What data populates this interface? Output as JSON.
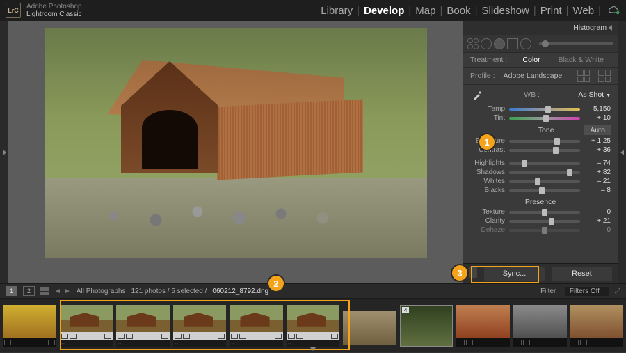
{
  "app": {
    "vendor": "Adobe Photoshop",
    "name": "Lightroom Classic",
    "logo": "LrC"
  },
  "modules": {
    "items": [
      "Library",
      "Develop",
      "Map",
      "Book",
      "Slideshow",
      "Print",
      "Web"
    ],
    "active": "Develop"
  },
  "panel": {
    "histogram_label": "Histogram",
    "treatment_label": "Treatment :",
    "treatment_color": "Color",
    "treatment_bw": "Black & White",
    "profile_label": "Profile :",
    "profile_value": "Adobe Landscape",
    "wb_label": "WB :",
    "wb_value": "As Shot",
    "temp": {
      "label": "Temp",
      "value": "5,150",
      "pos": 55
    },
    "tint": {
      "label": "Tint",
      "value": "+ 10",
      "pos": 52
    },
    "tone_label": "Tone",
    "auto_label": "Auto",
    "exposure": {
      "label": "Exposure",
      "value": "+ 1.25",
      "pos": 68
    },
    "contrast": {
      "label": "Contrast",
      "value": "+ 36",
      "pos": 66
    },
    "highlights": {
      "label": "Highlights",
      "value": "– 74",
      "pos": 22
    },
    "shadows": {
      "label": "Shadows",
      "value": "+ 82",
      "pos": 85
    },
    "whites": {
      "label": "Whites",
      "value": "– 21",
      "pos": 40
    },
    "blacks": {
      "label": "Blacks",
      "value": "– 8",
      "pos": 46
    },
    "presence_label": "Presence",
    "texture": {
      "label": "Texture",
      "value": "0",
      "pos": 50
    },
    "clarity": {
      "label": "Clarity",
      "value": "+ 21",
      "pos": 60
    },
    "dehaze": {
      "label": "Dehaze",
      "value": "0",
      "pos": 50
    },
    "sync_label": "Sync...",
    "reset_label": "Reset"
  },
  "toolbar": {
    "screen1": "1",
    "screen2": "2",
    "collection": "All Photographs",
    "counts": "121 photos / 5 selected /",
    "filename": "060212_8792.dng",
    "filter_label": "Filter :",
    "filter_value": "Filters Off"
  },
  "callouts": {
    "c1": "1",
    "c2": "2",
    "c3": "3"
  },
  "filmstrip": {
    "stack_count": "4"
  }
}
